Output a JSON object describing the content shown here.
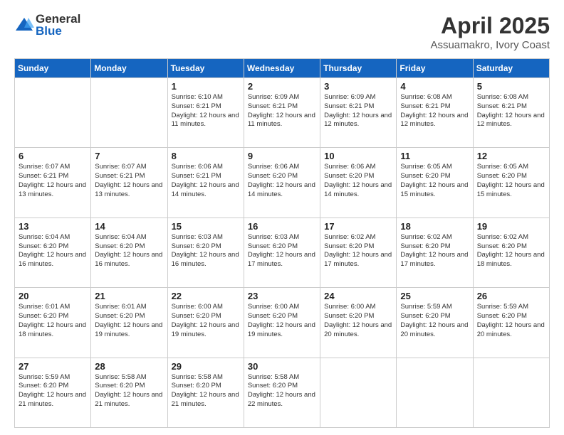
{
  "logo": {
    "general": "General",
    "blue": "Blue"
  },
  "title": "April 2025",
  "subtitle": "Assuamakro, Ivory Coast",
  "weekdays": [
    "Sunday",
    "Monday",
    "Tuesday",
    "Wednesday",
    "Thursday",
    "Friday",
    "Saturday"
  ],
  "weeks": [
    [
      {
        "day": "",
        "info": ""
      },
      {
        "day": "",
        "info": ""
      },
      {
        "day": "1",
        "info": "Sunrise: 6:10 AM\nSunset: 6:21 PM\nDaylight: 12 hours and 11 minutes."
      },
      {
        "day": "2",
        "info": "Sunrise: 6:09 AM\nSunset: 6:21 PM\nDaylight: 12 hours and 11 minutes."
      },
      {
        "day": "3",
        "info": "Sunrise: 6:09 AM\nSunset: 6:21 PM\nDaylight: 12 hours and 12 minutes."
      },
      {
        "day": "4",
        "info": "Sunrise: 6:08 AM\nSunset: 6:21 PM\nDaylight: 12 hours and 12 minutes."
      },
      {
        "day": "5",
        "info": "Sunrise: 6:08 AM\nSunset: 6:21 PM\nDaylight: 12 hours and 12 minutes."
      }
    ],
    [
      {
        "day": "6",
        "info": "Sunrise: 6:07 AM\nSunset: 6:21 PM\nDaylight: 12 hours and 13 minutes."
      },
      {
        "day": "7",
        "info": "Sunrise: 6:07 AM\nSunset: 6:21 PM\nDaylight: 12 hours and 13 minutes."
      },
      {
        "day": "8",
        "info": "Sunrise: 6:06 AM\nSunset: 6:21 PM\nDaylight: 12 hours and 14 minutes."
      },
      {
        "day": "9",
        "info": "Sunrise: 6:06 AM\nSunset: 6:20 PM\nDaylight: 12 hours and 14 minutes."
      },
      {
        "day": "10",
        "info": "Sunrise: 6:06 AM\nSunset: 6:20 PM\nDaylight: 12 hours and 14 minutes."
      },
      {
        "day": "11",
        "info": "Sunrise: 6:05 AM\nSunset: 6:20 PM\nDaylight: 12 hours and 15 minutes."
      },
      {
        "day": "12",
        "info": "Sunrise: 6:05 AM\nSunset: 6:20 PM\nDaylight: 12 hours and 15 minutes."
      }
    ],
    [
      {
        "day": "13",
        "info": "Sunrise: 6:04 AM\nSunset: 6:20 PM\nDaylight: 12 hours and 16 minutes."
      },
      {
        "day": "14",
        "info": "Sunrise: 6:04 AM\nSunset: 6:20 PM\nDaylight: 12 hours and 16 minutes."
      },
      {
        "day": "15",
        "info": "Sunrise: 6:03 AM\nSunset: 6:20 PM\nDaylight: 12 hours and 16 minutes."
      },
      {
        "day": "16",
        "info": "Sunrise: 6:03 AM\nSunset: 6:20 PM\nDaylight: 12 hours and 17 minutes."
      },
      {
        "day": "17",
        "info": "Sunrise: 6:02 AM\nSunset: 6:20 PM\nDaylight: 12 hours and 17 minutes."
      },
      {
        "day": "18",
        "info": "Sunrise: 6:02 AM\nSunset: 6:20 PM\nDaylight: 12 hours and 17 minutes."
      },
      {
        "day": "19",
        "info": "Sunrise: 6:02 AM\nSunset: 6:20 PM\nDaylight: 12 hours and 18 minutes."
      }
    ],
    [
      {
        "day": "20",
        "info": "Sunrise: 6:01 AM\nSunset: 6:20 PM\nDaylight: 12 hours and 18 minutes."
      },
      {
        "day": "21",
        "info": "Sunrise: 6:01 AM\nSunset: 6:20 PM\nDaylight: 12 hours and 19 minutes."
      },
      {
        "day": "22",
        "info": "Sunrise: 6:00 AM\nSunset: 6:20 PM\nDaylight: 12 hours and 19 minutes."
      },
      {
        "day": "23",
        "info": "Sunrise: 6:00 AM\nSunset: 6:20 PM\nDaylight: 12 hours and 19 minutes."
      },
      {
        "day": "24",
        "info": "Sunrise: 6:00 AM\nSunset: 6:20 PM\nDaylight: 12 hours and 20 minutes."
      },
      {
        "day": "25",
        "info": "Sunrise: 5:59 AM\nSunset: 6:20 PM\nDaylight: 12 hours and 20 minutes."
      },
      {
        "day": "26",
        "info": "Sunrise: 5:59 AM\nSunset: 6:20 PM\nDaylight: 12 hours and 20 minutes."
      }
    ],
    [
      {
        "day": "27",
        "info": "Sunrise: 5:59 AM\nSunset: 6:20 PM\nDaylight: 12 hours and 21 minutes."
      },
      {
        "day": "28",
        "info": "Sunrise: 5:58 AM\nSunset: 6:20 PM\nDaylight: 12 hours and 21 minutes."
      },
      {
        "day": "29",
        "info": "Sunrise: 5:58 AM\nSunset: 6:20 PM\nDaylight: 12 hours and 21 minutes."
      },
      {
        "day": "30",
        "info": "Sunrise: 5:58 AM\nSunset: 6:20 PM\nDaylight: 12 hours and 22 minutes."
      },
      {
        "day": "",
        "info": ""
      },
      {
        "day": "",
        "info": ""
      },
      {
        "day": "",
        "info": ""
      }
    ]
  ]
}
